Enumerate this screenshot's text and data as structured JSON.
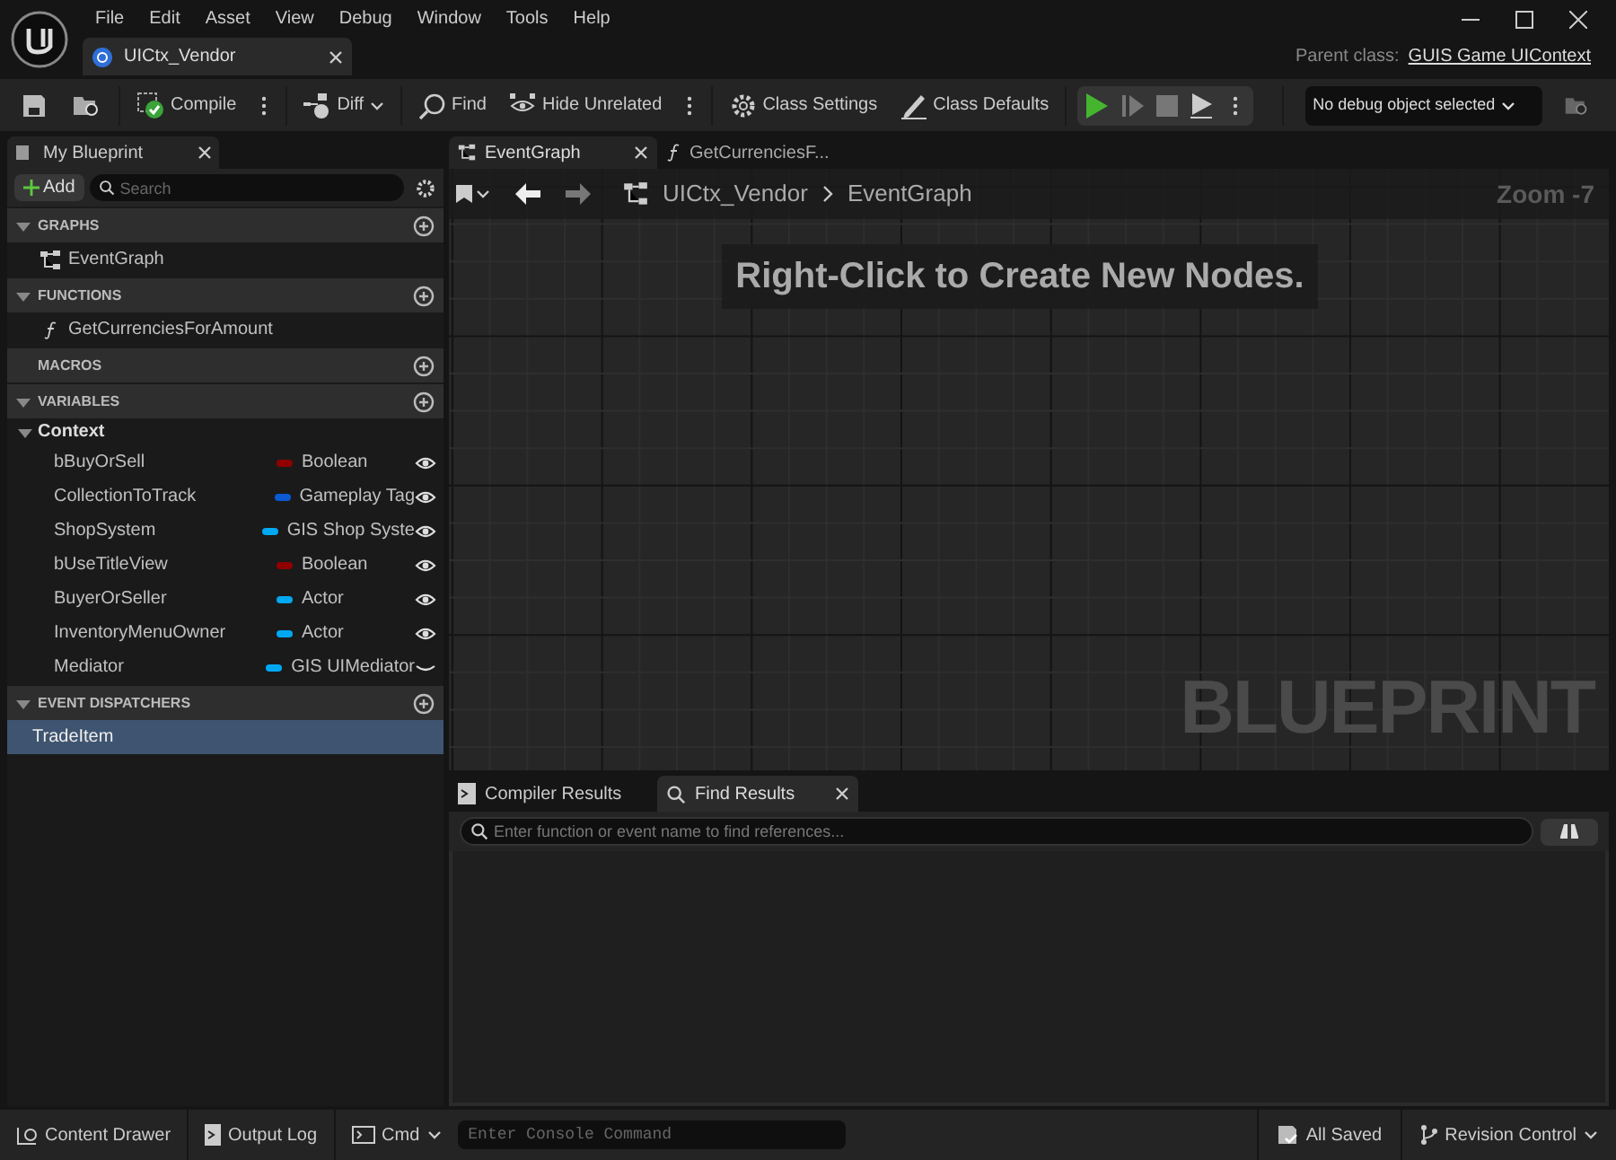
{
  "menu": [
    "File",
    "Edit",
    "Asset",
    "View",
    "Debug",
    "Window",
    "Tools",
    "Help"
  ],
  "document_tab": {
    "title": "UICtx_Vendor"
  },
  "parent_class": {
    "label": "Parent class:",
    "value": "GUIS Game UIContext"
  },
  "toolbar": [
    {
      "label": "Compile",
      "kind": "more"
    },
    {
      "label": "Diff",
      "kind": "dropdown"
    },
    {
      "label": "Find",
      "kind": "plain"
    },
    {
      "label": "Hide Unrelated",
      "kind": "more"
    },
    {
      "label": "Class Settings",
      "kind": "plain"
    },
    {
      "label": "Class Defaults",
      "kind": "plain"
    }
  ],
  "debug_select": {
    "value": "No debug object selected"
  },
  "my_blueprint": {
    "tab": "My Blueprint",
    "add_button": "Add",
    "search_placeholder": "Search",
    "sections": [
      {
        "title": "GRAPHS",
        "expanded": true,
        "items": [
          {
            "label": "EventGraph",
            "kind": "graph"
          }
        ]
      },
      {
        "title": "FUNCTIONS",
        "expanded": true,
        "items": [
          {
            "label": "GetCurrenciesForAmount",
            "kind": "function"
          }
        ]
      },
      {
        "title": "MACROS"
      },
      {
        "title": "VARIABLES",
        "expanded": true,
        "categories": [
          {
            "name": "Context",
            "expanded": true,
            "variables": [
              {
                "name": "bBuyOrSell",
                "type": "Boolean",
                "color": "#8f0000",
                "visible": true
              },
              {
                "name": "CollectionToTrack",
                "type": "Gameplay Tag",
                "color": "#0a5ad4",
                "visible": true
              },
              {
                "name": "ShopSystem",
                "type": "GIS Shop Syste",
                "color": "#00a8f2",
                "visible": true
              },
              {
                "name": "bUseTitleView",
                "type": "Boolean",
                "color": "#8f0000",
                "visible": true
              },
              {
                "name": "BuyerOrSeller",
                "type": "Actor",
                "color": "#00a8f2",
                "visible": true
              },
              {
                "name": "InventoryMenuOwner",
                "type": "Actor",
                "color": "#00a8f2",
                "visible": true
              },
              {
                "name": "Mediator",
                "type": "GIS UIMediator",
                "color": "#00a8f2",
                "visible": false
              }
            ]
          }
        ]
      },
      {
        "title": "EVENT DISPATCHERS",
        "expanded": true,
        "items": [
          {
            "label": "TradeItem",
            "kind": "dispatcher",
            "selected": true
          }
        ]
      }
    ]
  },
  "graph_tabs": [
    {
      "label": "EventGraph",
      "selected": true
    },
    {
      "label": "GetCurrenciesF...",
      "selected": false
    }
  ],
  "breadcrumb": [
    "UICtx_Vendor",
    "EventGraph"
  ],
  "zoom": "Zoom -7",
  "graph_hint": "Right-Click to Create New Nodes.",
  "graph_watermark": "BLUEPRINT",
  "bottom_tabs": [
    {
      "label": "Compiler Results",
      "selected": false
    },
    {
      "label": "Find Results",
      "selected": true
    }
  ],
  "find_placeholder": "Enter function or event name to find references...",
  "status_bar": {
    "content_drawer": "Content Drawer",
    "output_log": "Output Log",
    "cmd": "Cmd",
    "console_placeholder": "Enter Console Command",
    "saved": "All Saved",
    "revision_control": "Revision Control"
  }
}
